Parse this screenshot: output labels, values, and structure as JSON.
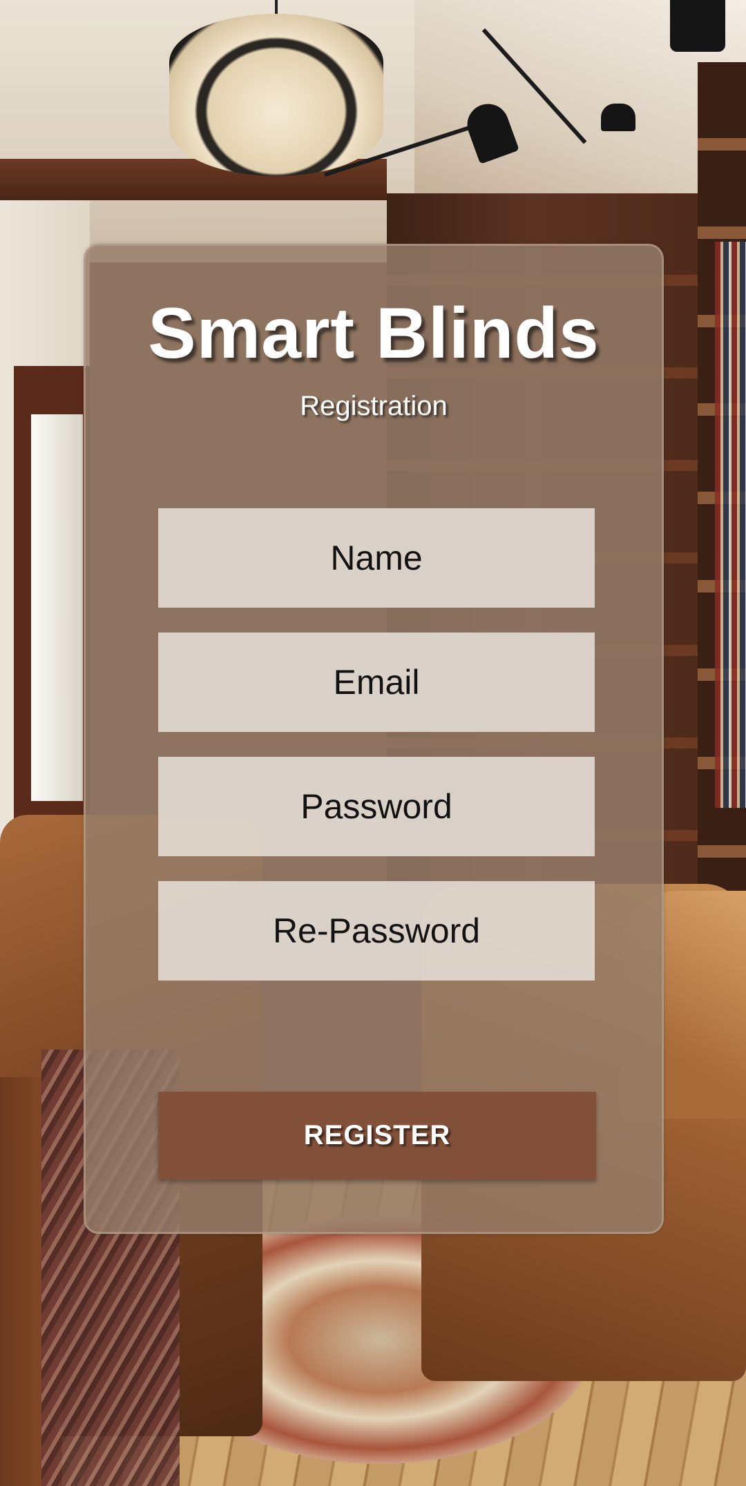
{
  "app": {
    "title": "Smart Blinds",
    "subtitle": "Registration"
  },
  "form": {
    "name": {
      "placeholder": "Name",
      "value": ""
    },
    "email": {
      "placeholder": "Email",
      "value": ""
    },
    "password": {
      "placeholder": "Password",
      "value": ""
    },
    "repassword": {
      "placeholder": "Re-Password",
      "value": ""
    },
    "submit_label": "REGISTER"
  },
  "colors": {
    "card_overlay": "#967e6a",
    "field_background": "#eee8e2",
    "button_background": "#83513a",
    "title_text": "#ffffff"
  },
  "background": {
    "image": "living-room-photo"
  }
}
